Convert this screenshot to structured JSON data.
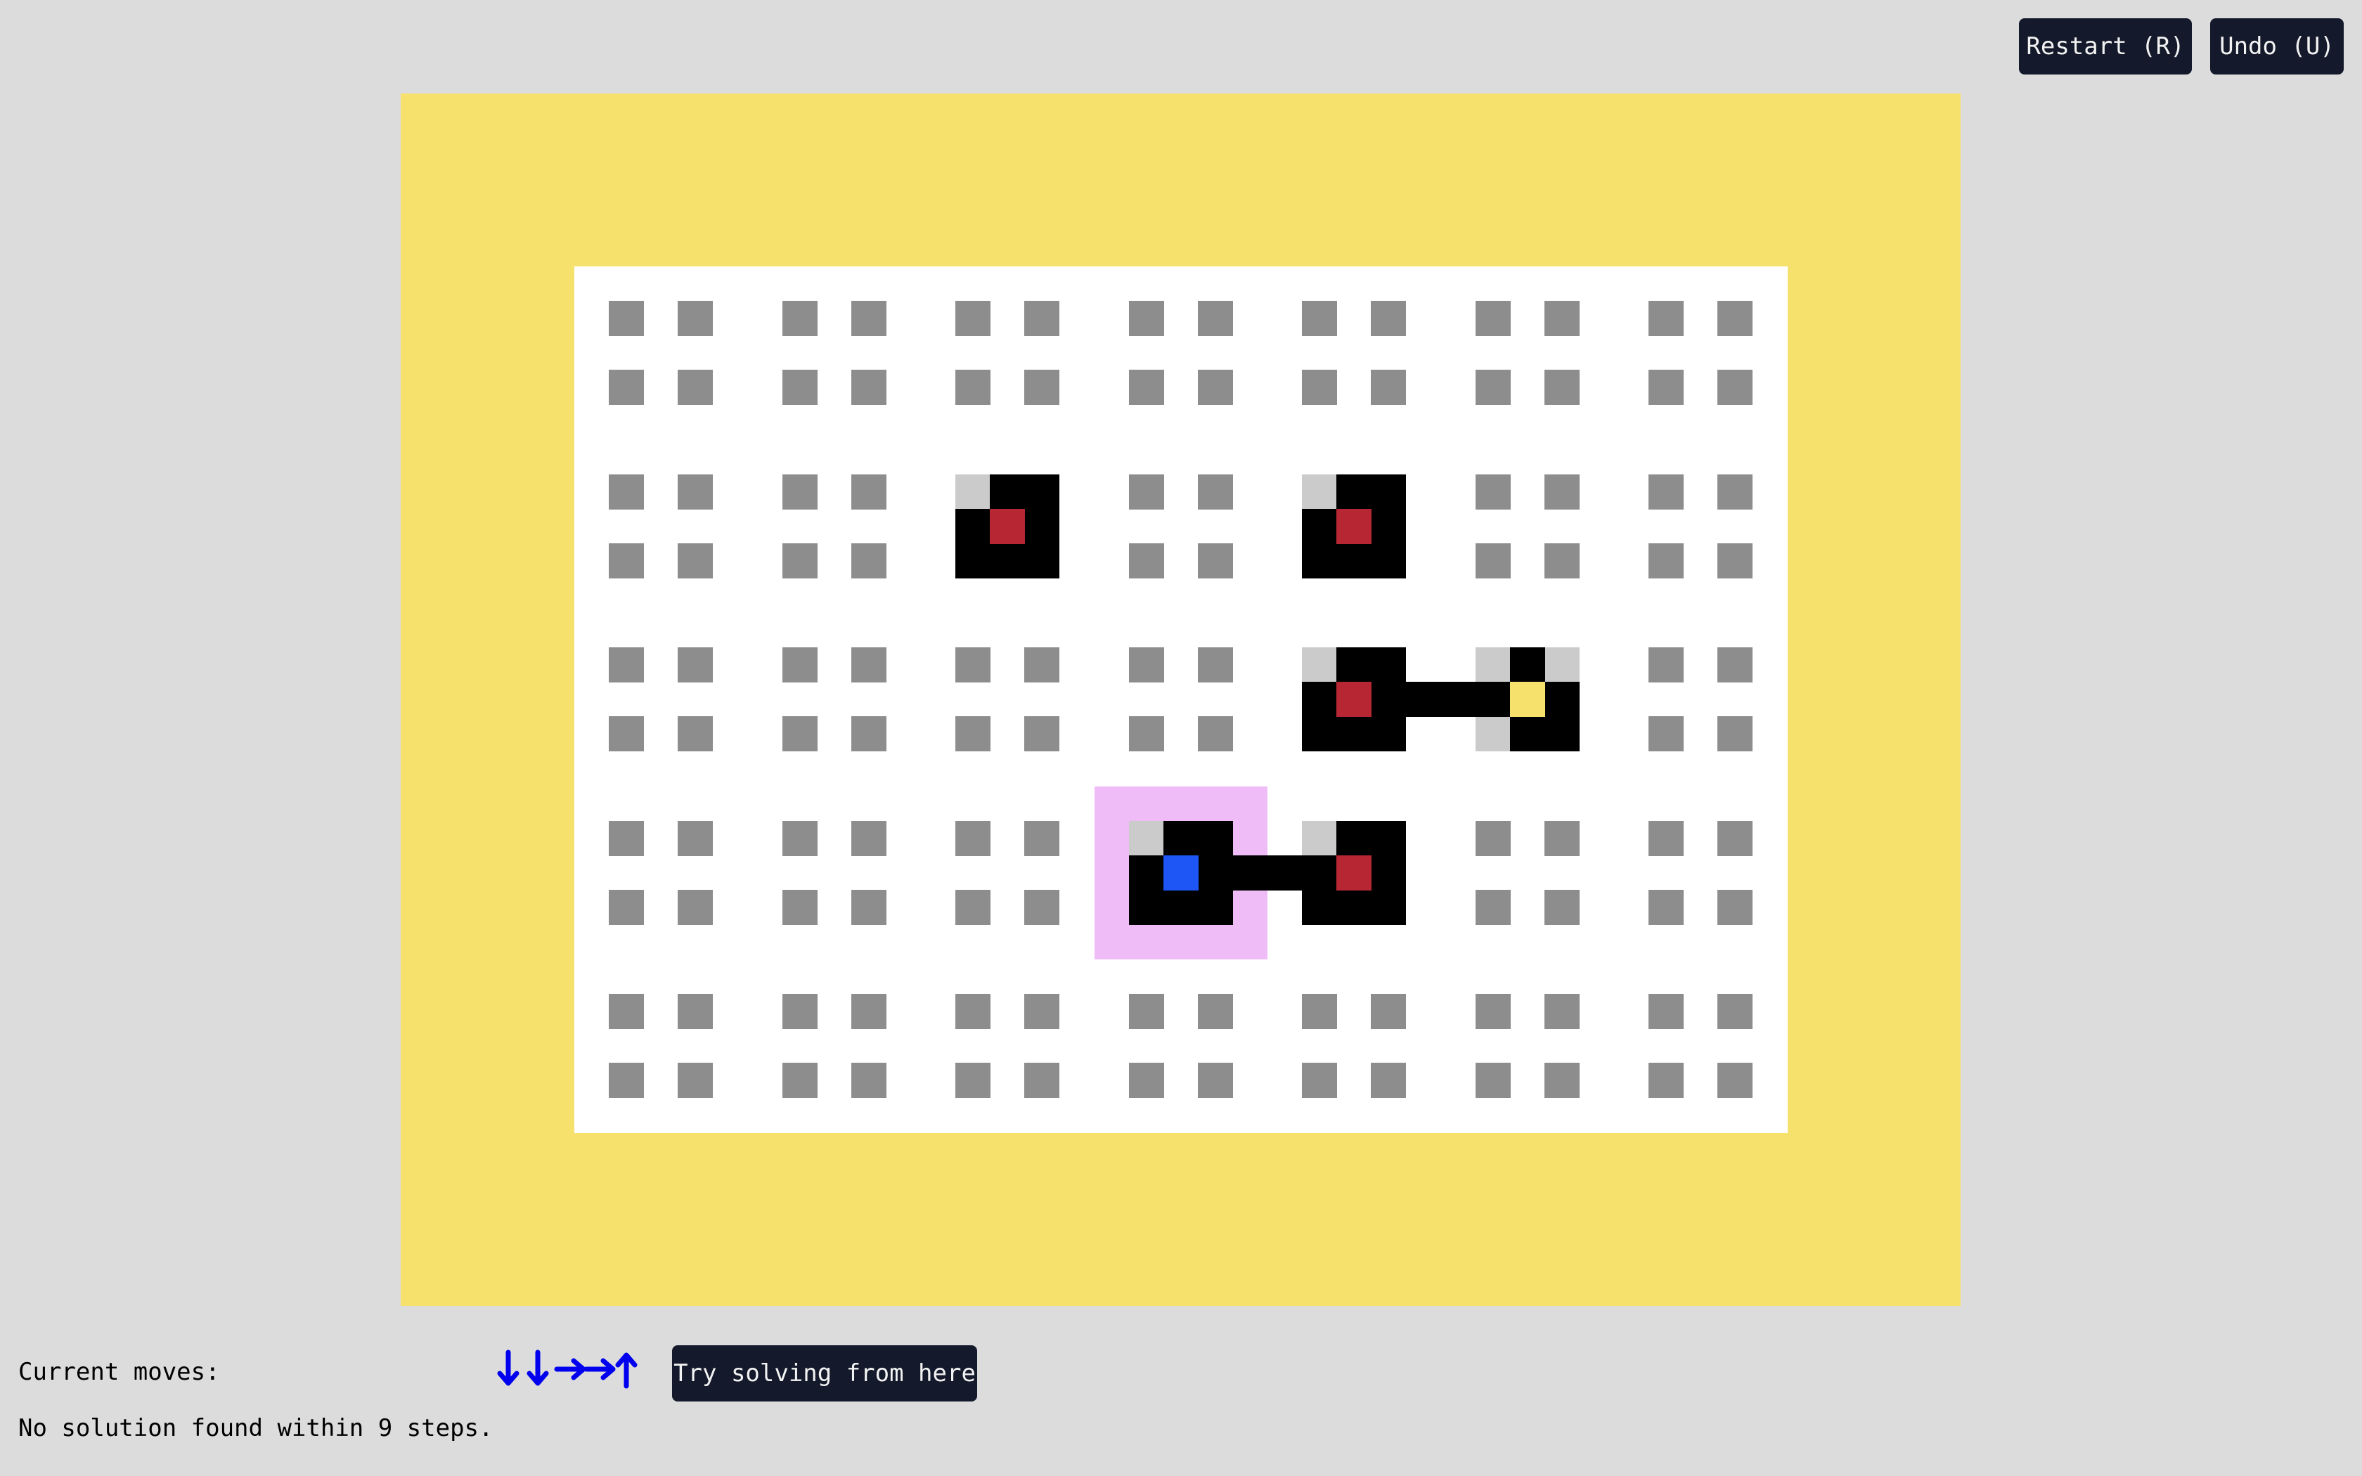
{
  "toolbar": {
    "restart_label": "Restart (R)",
    "undo_label": "Undo (U)"
  },
  "footer": {
    "moves_label": "Current moves:",
    "moves": [
      "down",
      "down",
      "right",
      "right",
      "up"
    ],
    "solve_label": "Try solving from here",
    "status": "No solution found within 9 steps."
  },
  "colors": {
    "background": "#dcdcdc",
    "frame": "#f6e16d",
    "board": "#ffffff",
    "empty_dot": "#8d8d8d",
    "block": "#000000",
    "corner": "#cbcbcb",
    "red_core": "#b72633",
    "blue_core": "#1d56f5",
    "yellow_core": "#f6e16d",
    "highlight": "#efbcf7",
    "arrow": "#0000ee"
  },
  "grid": {
    "cols": 7,
    "rows": 5,
    "pieces": [
      {
        "col": 2,
        "row": 1,
        "core": "red"
      },
      {
        "col": 4,
        "row": 1,
        "core": "red"
      },
      {
        "col": 4,
        "row": 2,
        "core": "red"
      },
      {
        "col": 5,
        "row": 2,
        "core": "yellow"
      },
      {
        "col": 3,
        "row": 3,
        "core": "blue",
        "selected": true
      },
      {
        "col": 4,
        "row": 3,
        "core": "red"
      }
    ],
    "links": [
      {
        "from": [
          4,
          2
        ],
        "to": [
          5,
          2
        ]
      },
      {
        "from": [
          3,
          3
        ],
        "to": [
          4,
          3
        ]
      }
    ]
  }
}
